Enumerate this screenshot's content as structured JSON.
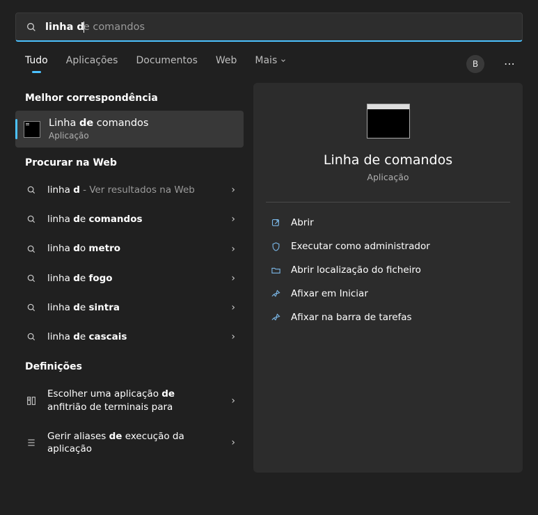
{
  "search": {
    "typed_bold": "linha d",
    "suggestion_rest": "e comandos"
  },
  "tabs": {
    "all": "Tudo",
    "apps": "Aplicações",
    "docs": "Documentos",
    "web": "Web",
    "more": "Mais"
  },
  "avatar_initial": "B",
  "sections": {
    "best_match": "Melhor correspondência",
    "web_search": "Procurar na Web",
    "settings": "Definições"
  },
  "best": {
    "title_pre": "Linha ",
    "title_bold": "de",
    "title_post": " comandos",
    "subtitle": "Aplicação"
  },
  "web_results": [
    {
      "pre": "linha ",
      "bold": "d",
      "post": "",
      "sub": " - Ver resultados na Web"
    },
    {
      "pre": "linha ",
      "bold": "d",
      "post": "e ",
      "bold2": "comandos"
    },
    {
      "pre": "linha ",
      "bold": "d",
      "post": "o ",
      "bold2": "metro"
    },
    {
      "pre": "linha ",
      "bold": "d",
      "post": "e ",
      "bold2": "fogo"
    },
    {
      "pre": "linha ",
      "bold": "d",
      "post": "e ",
      "bold2": "sintra"
    },
    {
      "pre": "linha ",
      "bold": "d",
      "post": "e ",
      "bold2": "cascais"
    }
  ],
  "settings_results": [
    {
      "line1_pre": "Escolher uma aplicação ",
      "line1_bold": "de",
      "line2": "anfitrião de terminais para"
    },
    {
      "line1_pre": "Gerir aliases ",
      "line1_bold": "de",
      "line1_post": " execução da",
      "line2": "aplicação"
    }
  ],
  "preview": {
    "title": "Linha de comandos",
    "subtitle": "Aplicação"
  },
  "actions": {
    "open": "Abrir",
    "admin": "Executar como administrador",
    "location": "Abrir localização do ficheiro",
    "pin_start": "Afixar em Iniciar",
    "pin_taskbar": "Afixar na barra de tarefas"
  }
}
